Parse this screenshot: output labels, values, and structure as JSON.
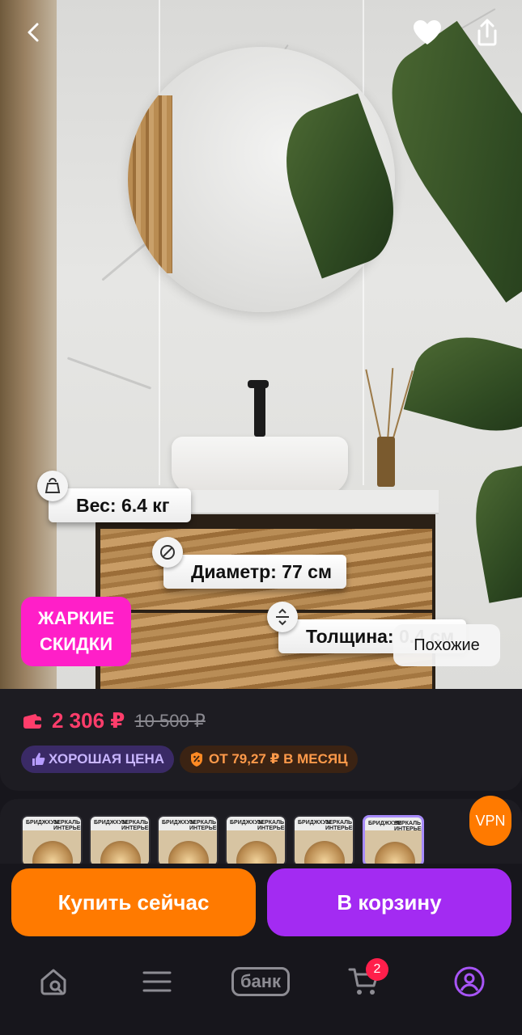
{
  "specs": {
    "weight": "Вес: 6.4 кг",
    "weight_icon_text": "6.4",
    "diameter": "Диаметр: 77 см",
    "thickness": "Толщина: 0.4 см"
  },
  "badges": {
    "hot_line1": "ЖАРКИЕ",
    "hot_line2": "СКИДКИ",
    "similar": "Похожие"
  },
  "price": {
    "current": "2 306 ₽",
    "old": "10 500 ₽",
    "tag_good": "ХОРОШАЯ ЦЕНА",
    "tag_month": "ОТ 79,27 ₽ В МЕСЯЦ"
  },
  "thumbnails": [
    {
      "brand": "БРИДЖХУМ",
      "title": "ЗЕРКАЛЬ ИНТЕРЬЕРНОЕ"
    },
    {
      "brand": "БРИДЖХУМ",
      "title": "ЗЕРКАЛЬ ИНТЕРЬЕРНОЕ"
    },
    {
      "brand": "БРИДЖХУМ",
      "title": "ЗЕРКАЛЬ ИНТЕРЬЕРНОЕ"
    },
    {
      "brand": "БРИДЖХУМ",
      "title": "ЗЕРКАЛЬ ИНТЕРЬЕРНОЕ"
    },
    {
      "brand": "БРИДЖХУМ",
      "title": "ЗЕРКАЛЬ ИНТЕРЬЕРНОЕ"
    },
    {
      "brand": "БРИДЖХУМ",
      "title": "ЗЕРКАЛЬ ИНТЕРЬЕРНОЕ"
    }
  ],
  "vpn": "VPN",
  "actions": {
    "buy_now": "Купить сейчас",
    "add_to_cart": "В корзину"
  },
  "nav": {
    "bank": "банк",
    "cart_count": "2"
  },
  "icons": {
    "back": "chevron-left-icon",
    "favorite": "heart-icon",
    "share": "share-icon",
    "home": "home-search-icon",
    "catalog": "menu-icon",
    "cart": "cart-icon",
    "profile": "profile-icon"
  },
  "colors": {
    "buy_button": "#ff7a00",
    "cart_button": "#a32bf2",
    "price": "#ff3d6b",
    "hot_badge": "#ff1fc8",
    "profile_active": "#a855f7"
  }
}
